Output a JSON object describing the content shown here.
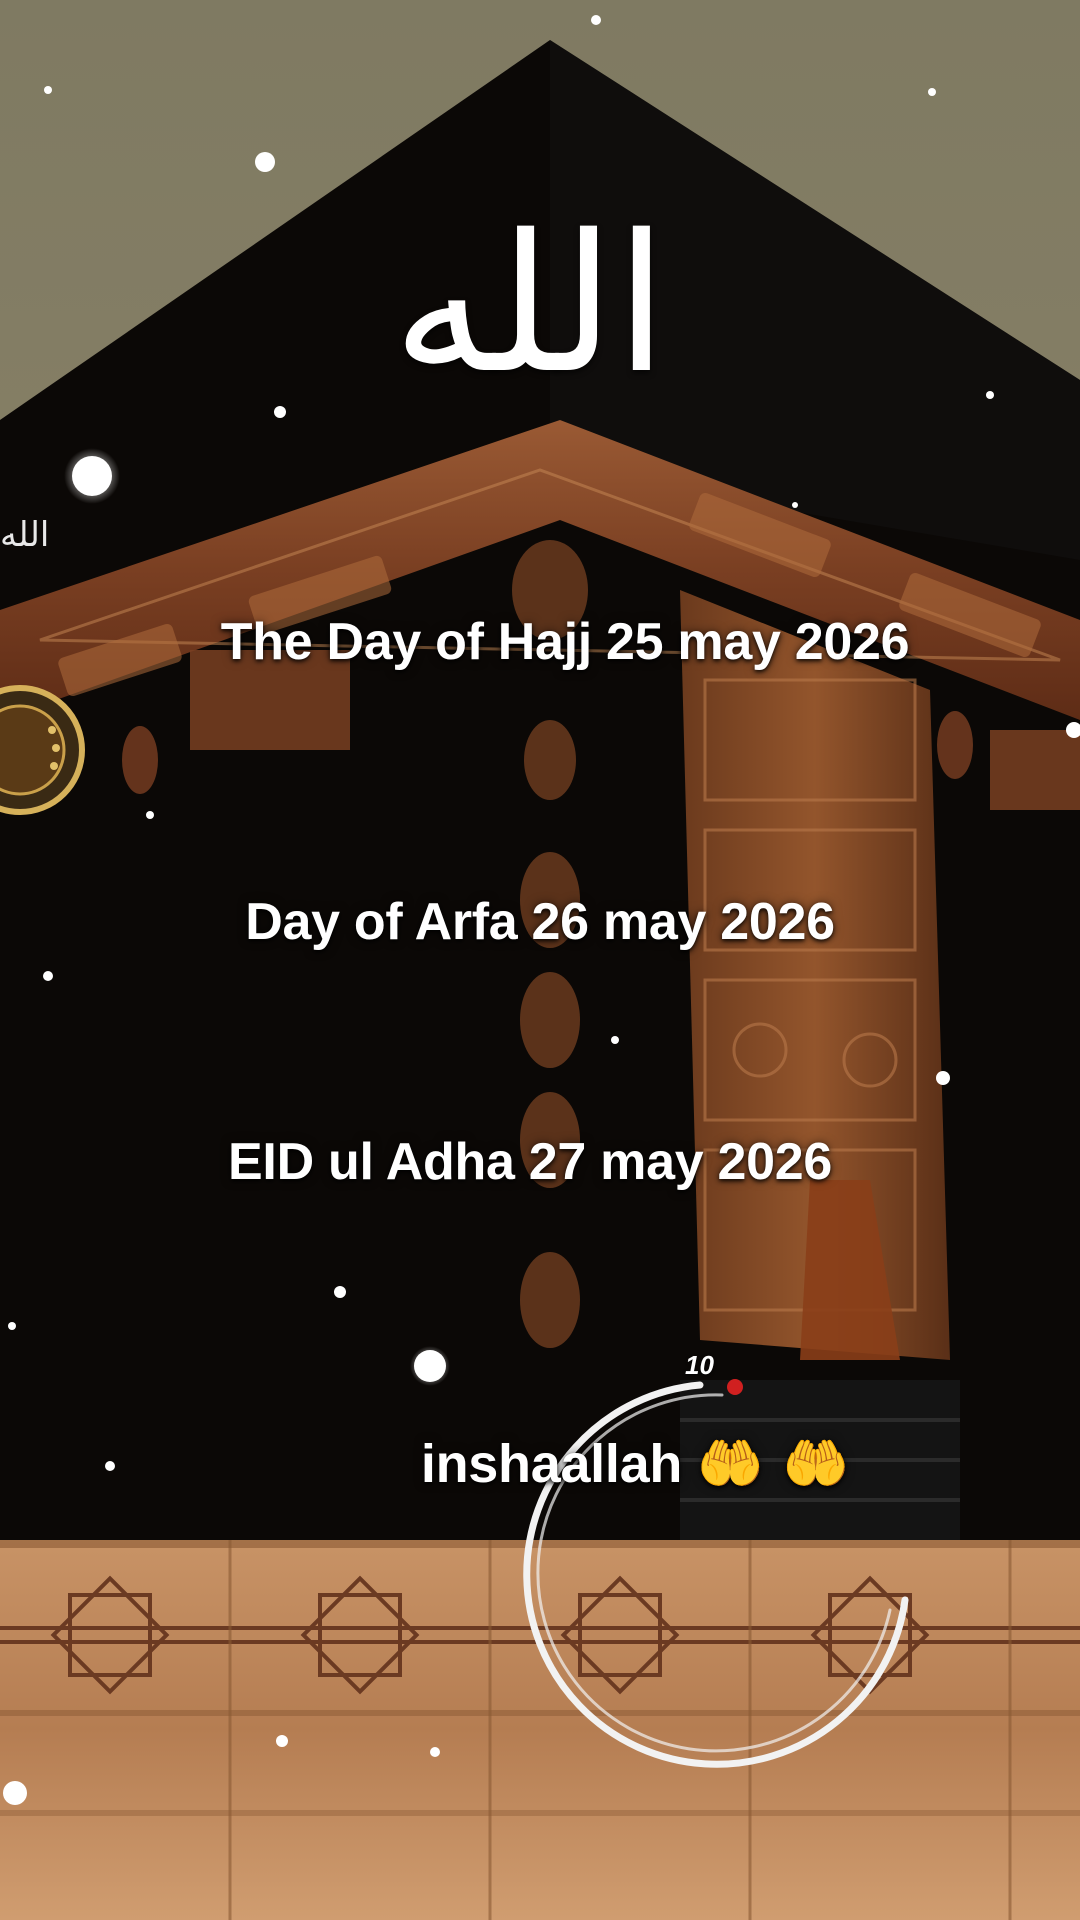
{
  "texts": {
    "hajj": "The Day of Hajj 25 may 2026",
    "arfa": "Day of Arfa 26 may 2026",
    "eid": "EID ul Adha 27 may 2026",
    "insha": "inshaallah",
    "emoji": "🤲 🤲"
  },
  "calligraphy": {
    "main": "الله",
    "small": "الله"
  },
  "timer": {
    "label": "10"
  },
  "colors": {
    "sky": "#8d8466",
    "kaaba": "#0b0806",
    "gold_band": "#8a4a2a",
    "ground": "#c08a5a"
  }
}
